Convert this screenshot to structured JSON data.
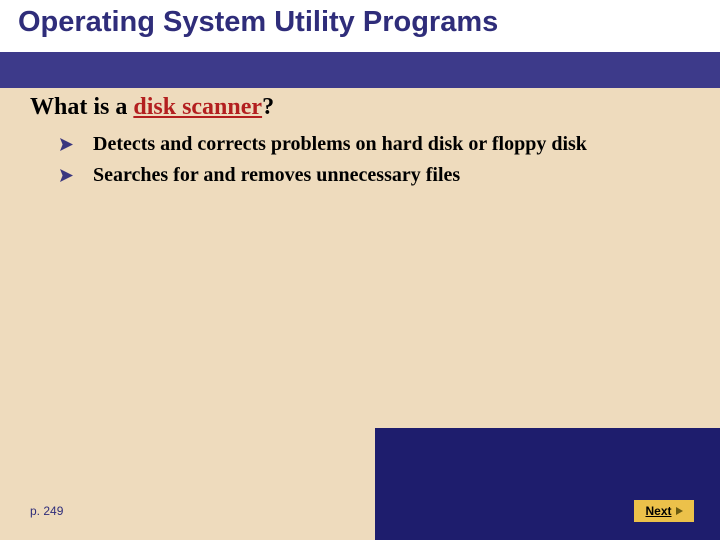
{
  "title": "Operating System Utility Programs",
  "question_prefix": "What is a ",
  "question_term": "disk scanner",
  "question_suffix": "?",
  "bullets": [
    "Detects and corrects problems on hard disk or floppy disk",
    "Searches for and removes unnecessary files"
  ],
  "page_ref": "p. 249",
  "next_label": "Next",
  "colors": {
    "slide_bg": "#eedbbd",
    "title_fg": "#2f2d7a",
    "bar": "#3d3a8a",
    "term": "#b31f1f",
    "bottom_blue": "#1e1d6d",
    "button_bg": "#ecc14a"
  }
}
